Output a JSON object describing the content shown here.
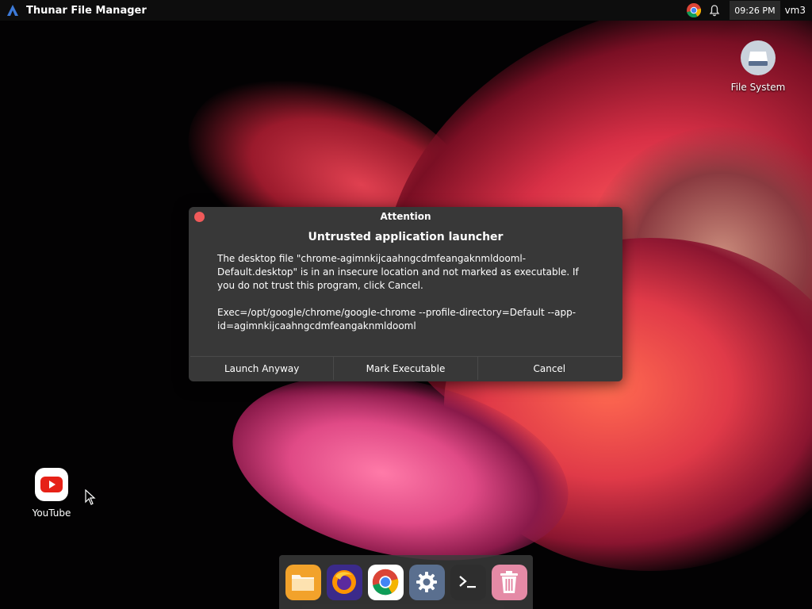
{
  "top_panel": {
    "app_title": "Thunar File Manager",
    "clock": "09:26 PM",
    "user": "vm3"
  },
  "desktop_icons": {
    "file_system": "File System",
    "youtube": "YouTube"
  },
  "dialog": {
    "title": "Attention",
    "heading": "Untrusted application launcher",
    "body": "The desktop file \"chrome-agimnkijcaahngcdmfeangaknmldooml-Default.desktop\" is in an insecure location and not marked as executable. If you do not trust this program, click Cancel.\n\nExec=/opt/google/chrome/google-chrome --profile-directory=Default --app-id=agimnkijcaahngcdmfeangaknmldooml",
    "buttons": {
      "launch": "Launch Anyway",
      "mark": "Mark Executable",
      "cancel": "Cancel"
    }
  },
  "dock": {
    "items": [
      "files-icon",
      "firefox-icon",
      "chrome-icon",
      "settings-icon",
      "terminal-icon",
      "trash-icon"
    ]
  },
  "colors": {
    "dialog_bg": "#383838",
    "close_button": "#f05a5a",
    "panel_bg": "#0d0d0d"
  }
}
